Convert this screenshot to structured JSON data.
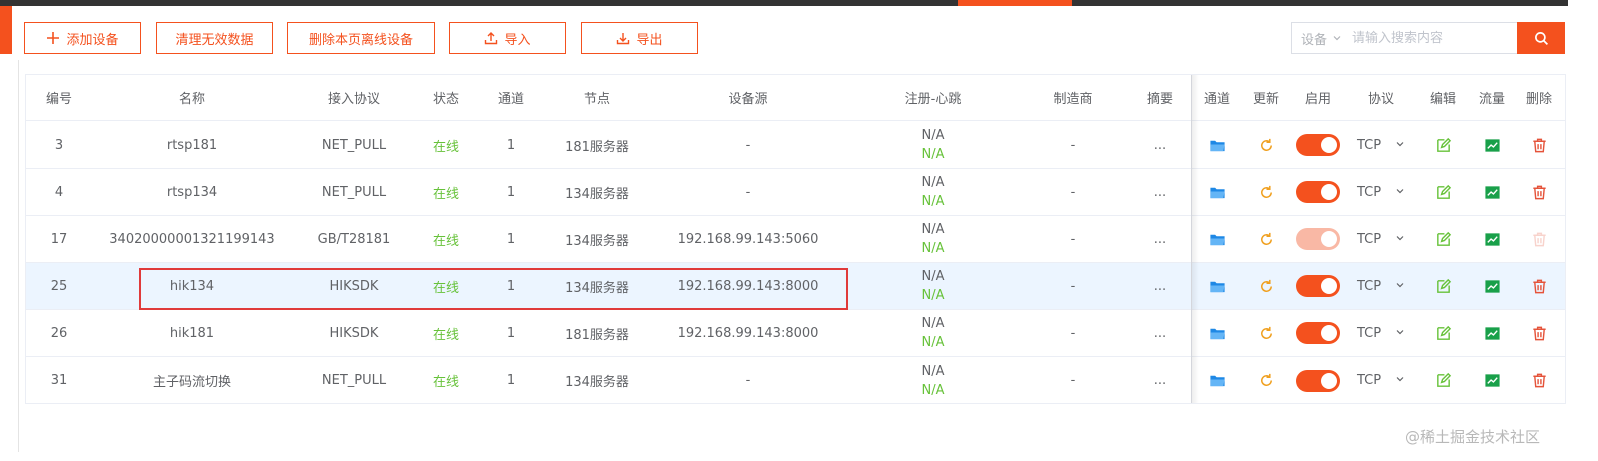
{
  "toolbar": {
    "add_device": "添加设备",
    "clean_invalid": "清理无效数据",
    "delete_offline": "删除本页离线设备",
    "import": "导入",
    "export": "导出"
  },
  "search": {
    "filter_label": "设备",
    "placeholder": "请输入搜索内容"
  },
  "table": {
    "headers": {
      "id": "编号",
      "name": "名称",
      "protocol": "接入协议",
      "status": "状态",
      "channels": "通道",
      "node": "节点",
      "source": "设备源",
      "register": "注册-心跳",
      "vendor": "制造商",
      "summary": "摘要",
      "channel_action": "通道",
      "refresh": "更新",
      "enable": "启用",
      "transport": "协议",
      "edit": "编辑",
      "traffic": "流量",
      "delete": "删除"
    },
    "rows": [
      {
        "id": "3",
        "name": "rtsp181",
        "protocol": "NET_PULL",
        "status": "在线",
        "channels": "1",
        "node": "181服务器",
        "source": "-",
        "register": "N/A",
        "heartbeat": "N/A",
        "vendor": "-",
        "summary": "...",
        "transport": "TCP"
      },
      {
        "id": "4",
        "name": "rtsp134",
        "protocol": "NET_PULL",
        "status": "在线",
        "channels": "1",
        "node": "134服务器",
        "source": "-",
        "register": "N/A",
        "heartbeat": "N/A",
        "vendor": "-",
        "summary": "...",
        "transport": "TCP"
      },
      {
        "id": "17",
        "name": "34020000001321199143",
        "protocol": "GB/T28181",
        "status": "在线",
        "channels": "1",
        "node": "134服务器",
        "source": "192.168.99.143:5060",
        "register": "N/A",
        "heartbeat": "N/A",
        "vendor": "-",
        "summary": "...",
        "transport": "TCP"
      },
      {
        "id": "25",
        "name": "hik134",
        "protocol": "HIKSDK",
        "status": "在线",
        "channels": "1",
        "node": "134服务器",
        "source": "192.168.99.143:8000",
        "register": "N/A",
        "heartbeat": "N/A",
        "vendor": "-",
        "summary": "...",
        "transport": "TCP"
      },
      {
        "id": "26",
        "name": "hik181",
        "protocol": "HIKSDK",
        "status": "在线",
        "channels": "1",
        "node": "181服务器",
        "source": "192.168.99.143:8000",
        "register": "N/A",
        "heartbeat": "N/A",
        "vendor": "-",
        "summary": "...",
        "transport": "TCP"
      },
      {
        "id": "31",
        "name": "主子码流切换",
        "protocol": "NET_PULL",
        "status": "在线",
        "channels": "1",
        "node": "134服务器",
        "source": "-",
        "register": "N/A",
        "heartbeat": "N/A",
        "vendor": "-",
        "summary": "...",
        "transport": "TCP"
      }
    ]
  },
  "watermark": "@稀土掘金技术社区",
  "colors": {
    "accent": "#f4511e",
    "online": "#67c23a",
    "folder": "#1e88e5",
    "refresh": "#f0a020",
    "edit": "#67c23a",
    "traffic": "#19a04a",
    "delete": "#e5533a"
  }
}
